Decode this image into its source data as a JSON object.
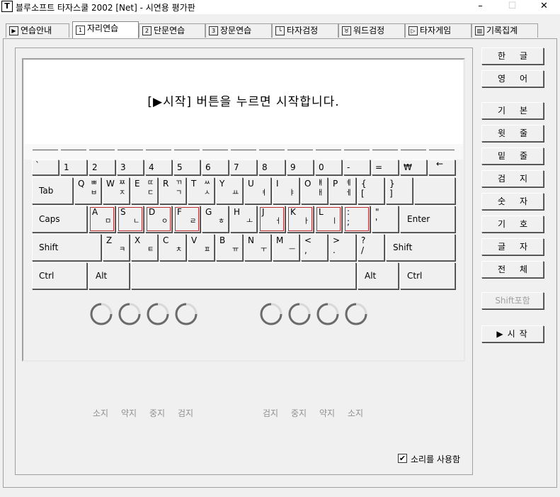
{
  "window": {
    "title": "블루소프트 타자스쿨 2002 [Net] - 시연용 평가판",
    "app_icon": "T",
    "controls": {
      "minimize": "–",
      "maximize": "☐",
      "close": "✕"
    }
  },
  "tabs": [
    {
      "label": "연습안내",
      "icon": "▶"
    },
    {
      "label": "자리연습",
      "icon": "1"
    },
    {
      "label": "단문연습",
      "icon": "2"
    },
    {
      "label": "장문연습",
      "icon": "3"
    },
    {
      "label": "타자검정",
      "icon": "└"
    },
    {
      "label": "워드검정",
      "icon": "♉"
    },
    {
      "label": "타자게임",
      "icon": "▷"
    },
    {
      "label": "기록집계",
      "icon": "▥"
    }
  ],
  "display": {
    "message": "[▶시작] 버튼을 누르면 시작합니다."
  },
  "keyboard": {
    "row1": [
      {
        "top": "`"
      },
      {
        "top": "1"
      },
      {
        "top": "2"
      },
      {
        "top": "3"
      },
      {
        "top": "4"
      },
      {
        "top": "5"
      },
      {
        "top": "6"
      },
      {
        "top": "7"
      },
      {
        "top": "8"
      },
      {
        "top": "9"
      },
      {
        "top": "0"
      },
      {
        "top": "-"
      },
      {
        "top": "="
      },
      {
        "top": "₩"
      },
      {
        "top": "←"
      }
    ],
    "row2": [
      {
        "label": "Tab"
      },
      {
        "top": "Q",
        "shift": "ㅃ",
        "ko": "ㅂ"
      },
      {
        "top": "W",
        "shift": "ㅉ",
        "ko": "ㅈ"
      },
      {
        "top": "E",
        "shift": "ㄸ",
        "ko": "ㄷ"
      },
      {
        "top": "R",
        "shift": "ㄲ",
        "ko": "ㄱ"
      },
      {
        "top": "T",
        "shift": "ㅆ",
        "ko": "ㅅ"
      },
      {
        "top": "Y",
        "shift": "",
        "ko": "ㅛ"
      },
      {
        "top": "U",
        "shift": "",
        "ko": "ㅕ"
      },
      {
        "top": "I",
        "shift": "",
        "ko": "ㅑ"
      },
      {
        "top": "O",
        "shift": "ㅒ",
        "ko": "ㅐ"
      },
      {
        "top": "P",
        "shift": "ㅖ",
        "ko": "ㅔ"
      },
      {
        "top": "{",
        "shift": "",
        "ko": "["
      },
      {
        "top": "}",
        "shift": "",
        "ko": "]"
      }
    ],
    "row3": [
      {
        "label": "Caps"
      },
      {
        "top": "A",
        "ko": "ㅁ"
      },
      {
        "top": "S",
        "ko": "ㄴ"
      },
      {
        "top": "D",
        "ko": "ㅇ"
      },
      {
        "top": "F",
        "ko": "ㄹ"
      },
      {
        "top": "G",
        "ko": "ㅎ"
      },
      {
        "top": "H",
        "ko": "ㅗ"
      },
      {
        "top": "J",
        "ko": "ㅓ"
      },
      {
        "top": "K",
        "ko": "ㅏ"
      },
      {
        "top": "L",
        "ko": "ㅣ"
      },
      {
        "top": ":",
        "ko": ";"
      },
      {
        "top": "\"",
        "ko": "'"
      },
      {
        "label": "Enter"
      }
    ],
    "row4": [
      {
        "label": "Shift"
      },
      {
        "top": "Z",
        "ko": "ㅋ"
      },
      {
        "top": "X",
        "ko": "ㅌ"
      },
      {
        "top": "C",
        "ko": "ㅊ"
      },
      {
        "top": "V",
        "ko": "ㅍ"
      },
      {
        "top": "B",
        "ko": "ㅠ"
      },
      {
        "top": "N",
        "ko": "ㅜ"
      },
      {
        "top": "M",
        "ko": "ㅡ"
      },
      {
        "top": "<",
        "ko": ","
      },
      {
        "top": ">",
        "ko": "."
      },
      {
        "top": "?",
        "ko": "/"
      },
      {
        "label": "Shift"
      }
    ],
    "row5": [
      {
        "label": "Ctrl"
      },
      {
        "label": "Alt"
      },
      {
        "label": ""
      },
      {
        "label": "Alt"
      },
      {
        "label": "Ctrl"
      }
    ]
  },
  "finger_labels": {
    "left": [
      "소지",
      "약지",
      "중지",
      "검지"
    ],
    "right": [
      "검지",
      "중지",
      "약지",
      "소지"
    ]
  },
  "side_buttons": [
    {
      "label": "한글"
    },
    {
      "label": "영어"
    },
    {
      "label": "기본"
    },
    {
      "label": "윗줄"
    },
    {
      "label": "밑줄"
    },
    {
      "label": "검지"
    },
    {
      "label": "숫자"
    },
    {
      "label": "기호"
    },
    {
      "label": "글자"
    },
    {
      "label": "전체"
    },
    {
      "label": "Shift포함"
    },
    {
      "label": "▶시작"
    }
  ],
  "sound_checkbox": {
    "label": "소리를 사용함",
    "checked": "✔"
  }
}
